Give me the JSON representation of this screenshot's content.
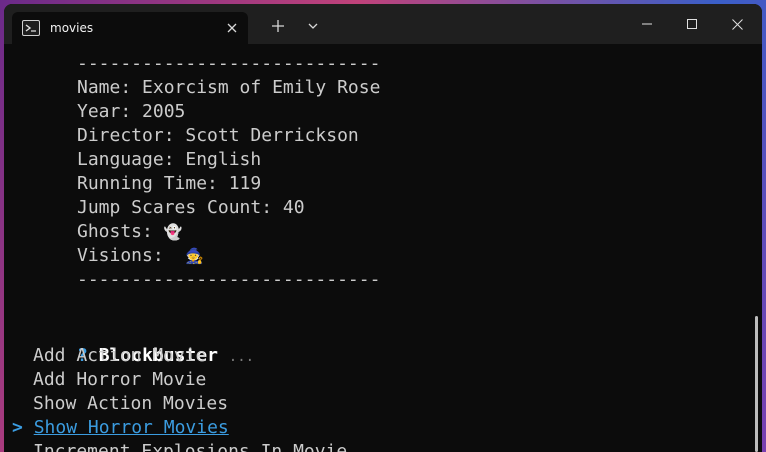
{
  "window": {
    "tab_title": "movies"
  },
  "icons": {
    "shell": "terminal-icon",
    "close_tab": "close-icon",
    "new_tab": "plus-icon",
    "dropdown": "chevron-down-icon",
    "minimize": "minimize-icon",
    "maximize": "maximize-icon",
    "close_window": "close-icon"
  },
  "colors": {
    "accent": "#3b9ce0",
    "background": "#0c0c0c",
    "titlebar": "#1f1f1f",
    "text": "#cccccc"
  },
  "movie": {
    "separator_top": "----------------------------",
    "name": "Name: Exorcism of Emily Rose",
    "year": "Year: 2005",
    "director": "Director: Scott Derrickson",
    "language": "Language: English",
    "running_time": "Running Time: 119",
    "jump_scares": "Jump Scares Count: 40",
    "ghosts_label": "Ghosts: ",
    "ghosts_emoji": "👻",
    "visions_label": "Visions:  ",
    "visions_emoji": "🧙",
    "separator_bottom": "----------------------------"
  },
  "menu": {
    "prompt_symbol": "?",
    "title": "Blockbuster",
    "hint": "...",
    "cursor": ">",
    "items": [
      "Add Action Movie",
      "Add Horror Movie",
      "Show Action Movies",
      "Show Horror Movies",
      "Increment Explosions In Movie"
    ],
    "selected_index": 3
  }
}
